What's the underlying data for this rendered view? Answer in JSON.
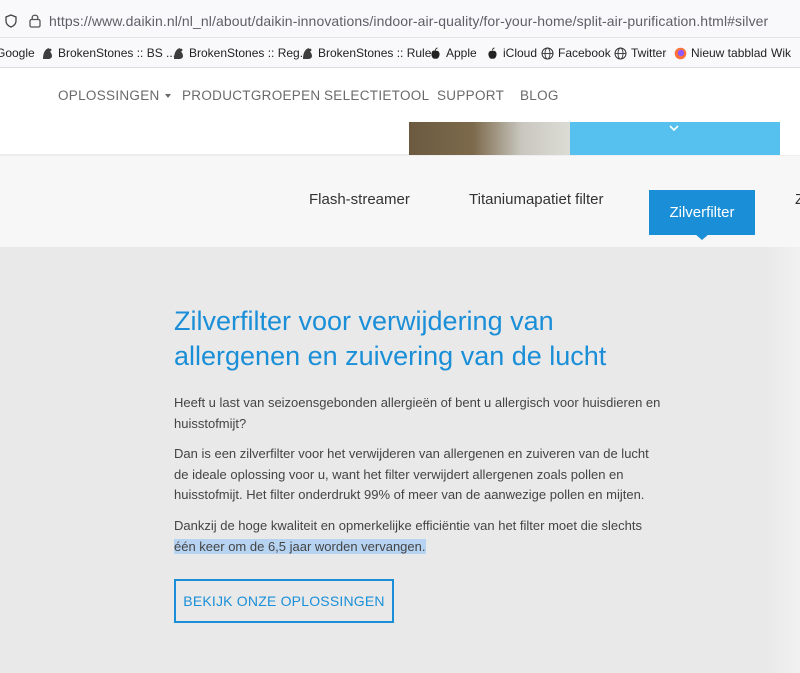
{
  "browser": {
    "url": "https://www.daikin.nl/nl_nl/about/daikin-innovations/indoor-air-quality/for-your-home/split-air-purification.html#silver"
  },
  "bookmarks": [
    {
      "label": "Google",
      "icon": "google-icon"
    },
    {
      "label": "BrokenStones :: BS ...",
      "icon": "brokenstones-icon"
    },
    {
      "label": "BrokenStones :: Reg...",
      "icon": "brokenstones-icon"
    },
    {
      "label": "BrokenStones :: Rules",
      "icon": "brokenstones-icon"
    },
    {
      "label": "Apple",
      "icon": "apple-icon"
    },
    {
      "label": "iCloud",
      "icon": "apple-icon"
    },
    {
      "label": "Facebook",
      "icon": "globe-icon"
    },
    {
      "label": "Twitter",
      "icon": "globe-icon"
    },
    {
      "label": "Nieuw tabblad",
      "icon": "firefox-icon"
    },
    {
      "label": "Wik",
      "icon": "wikipedia-icon"
    }
  ],
  "nav": {
    "items": [
      "OPLOSSINGEN",
      "PRODUCTGROEPEN",
      "SELECTIETOOL",
      "SUPPORT",
      "BLOG"
    ]
  },
  "tabs": {
    "items": [
      "Flash-streamer",
      "Titaniumapatiet filter"
    ],
    "active": "Zilverfilter",
    "cut": "Z"
  },
  "content": {
    "heading": "Zilverfilter voor verwijdering van allergenen en zuivering van de lucht",
    "p1": "Heeft u last van seizoensgebonden allergieën of bent u allergisch voor huisdieren en huisstofmijt?",
    "p2": "Dan is een zilverfilter voor het verwijderen van allergenen en zuiveren van de lucht de ideale oplossing voor u, want het filter verwijdert allergenen zoals pollen en huisstofmijt. Het filter onderdrukt 99% of meer van de aanwezige pollen en mijten.",
    "p3_a": "Dankzij de hoge kwaliteit en opmerkelijke efficiëntie van het filter moet die slechts ",
    "p3_b": "één keer om de 6,5 jaar worden vervangen.",
    "cta": "BEKIJK ONZE OPLOSSINGEN"
  },
  "colors": {
    "accent": "#1a8fd8",
    "header_cta": "#56c1ee",
    "content_bg": "#e9e9e9",
    "selection": "#b7d3f2"
  }
}
